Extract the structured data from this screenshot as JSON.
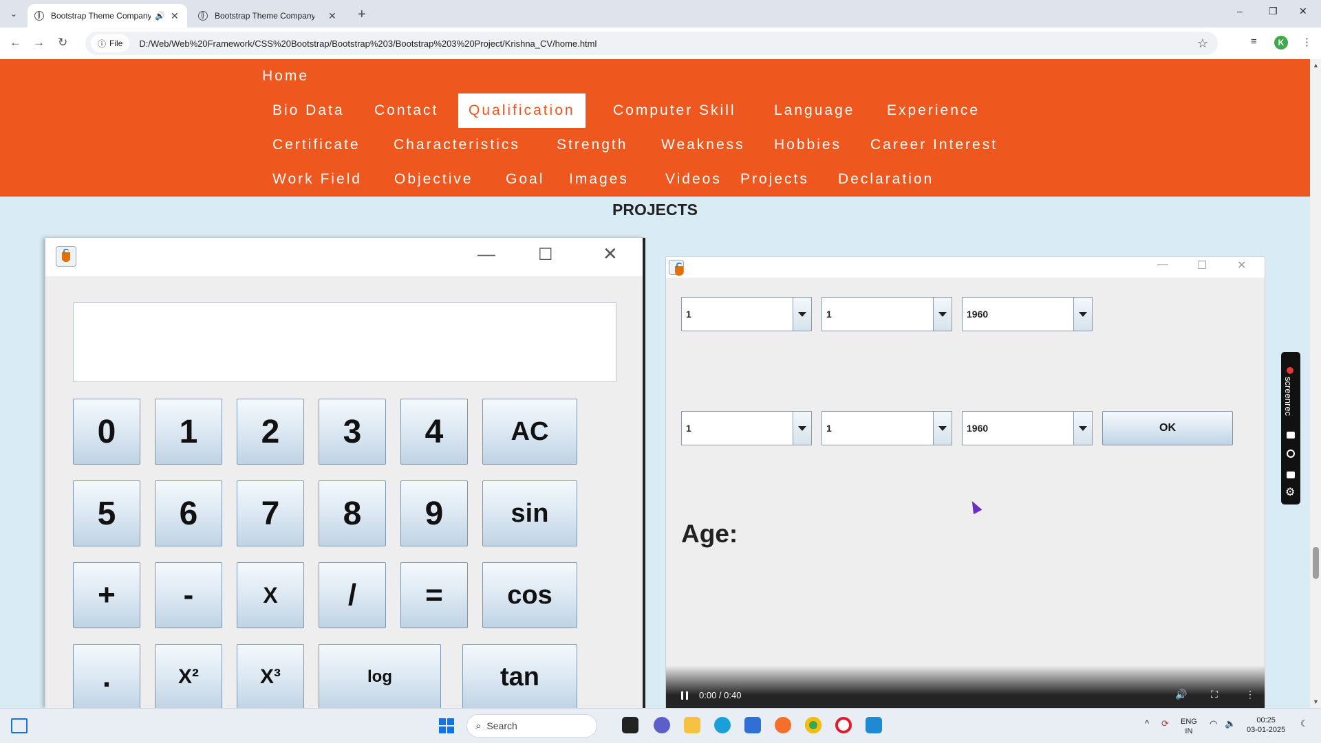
{
  "browser": {
    "tabs": [
      {
        "title": "Bootstrap Theme Company",
        "active": true
      },
      {
        "title": "Bootstrap Theme Company Pa",
        "active": false
      }
    ],
    "new_tab": "+",
    "window_controls": {
      "minimize": "–",
      "restore": "❐",
      "close": "✕"
    },
    "site_info_label": "File",
    "url": "D:/Web/Web%20Framework/CSS%20Bootstrap/Bootstrap%203/Bootstrap%203%20Project/Krishna_CV/home.html",
    "profile_initial": "K"
  },
  "navbar": {
    "color": "#ee571e",
    "items": [
      {
        "label": "Home"
      },
      {
        "label": "Bio Data"
      },
      {
        "label": "Contact"
      },
      {
        "label": "Qualification",
        "active": true
      },
      {
        "label": "Computer Skill"
      },
      {
        "label": "Language"
      },
      {
        "label": "Experience"
      },
      {
        "label": "Certificate"
      },
      {
        "label": "Characteristics"
      },
      {
        "label": "Strength"
      },
      {
        "label": "Weakness"
      },
      {
        "label": "Hobbies"
      },
      {
        "label": "Career Interest"
      },
      {
        "label": "Work Field"
      },
      {
        "label": "Objective"
      },
      {
        "label": "Goal"
      },
      {
        "label": "Images"
      },
      {
        "label": "Videos"
      },
      {
        "label": "Projects"
      },
      {
        "label": "Declaration"
      }
    ]
  },
  "page": {
    "heading": "PROJECTS"
  },
  "calculator": {
    "display_value": "",
    "keys": [
      "0",
      "1",
      "2",
      "3",
      "4",
      "AC",
      "5",
      "6",
      "7",
      "8",
      "9",
      "sin",
      "+",
      "-",
      "X",
      "/",
      "=",
      "cos",
      ".",
      "X²",
      "X³",
      "log",
      "tan"
    ]
  },
  "age_app": {
    "row1": {
      "day": "1",
      "month": "1",
      "year": "1960"
    },
    "row2": {
      "day": "1",
      "month": "1",
      "year": "1960"
    },
    "ok_label": "OK",
    "age_label": "Age:"
  },
  "video": {
    "time": "0:00 / 0:40"
  },
  "screenrec": {
    "label": "screenrec"
  },
  "taskbar": {
    "search_placeholder": "Search",
    "lang": "ENG",
    "region": "IN",
    "time": "00:25",
    "date": "03-01-2025"
  }
}
